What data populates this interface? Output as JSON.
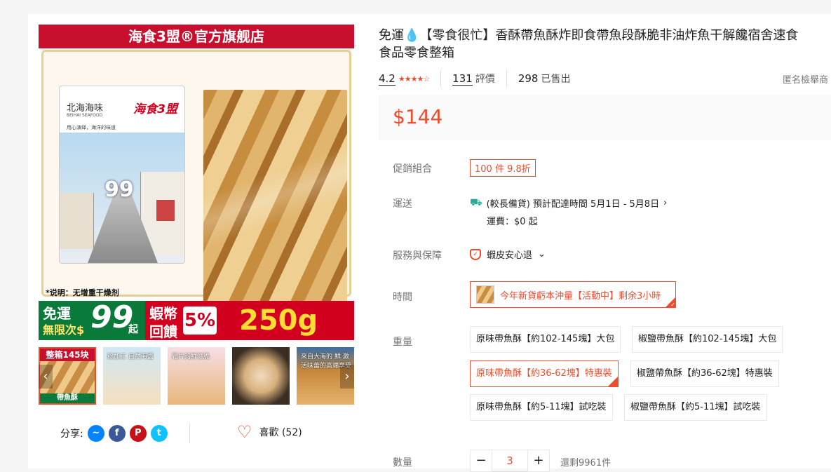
{
  "gallery": {
    "banner_top": "海食3盟®官方旗舰店",
    "package": {
      "name_cn": "北海海味",
      "name_en": "BEIHAI SEAFOOD",
      "brand": "海食3盟",
      "slogan": "用心演绎，海洋的味道",
      "badge": "99"
    },
    "note": "*说明：无增重干燥剂",
    "promo": {
      "free_ship_line1": "免運",
      "free_ship_line2": "無限次",
      "dollar": "$",
      "amount": "99",
      "unit": "起",
      "coin_line1": "蝦幣",
      "coin_line2": "回饋",
      "coin_pct": "5%",
      "weight": "250g"
    },
    "thumbs": [
      {
        "label_top": "整箱145块",
        "label_bottom": "帶魚酥"
      },
      {
        "label": "餘加工 自然海鹽"
      },
      {
        "label": "鬆片的鮮滋脆"
      },
      {
        "label": ""
      },
      {
        "label": "來自大海的 鮮 激活味蕾的高端享受"
      }
    ],
    "prev_arrow": "‹",
    "next_arrow": "›"
  },
  "share": {
    "label": "分享:",
    "icons": [
      "messenger-icon",
      "facebook-icon",
      "pinterest-icon",
      "twitter-icon"
    ]
  },
  "like": {
    "label": "喜歡 (52)"
  },
  "product": {
    "title": "免運💧【零食很忙】香酥帶魚酥炸即食帶魚段酥脆非油炸魚干解饞宿舍速食",
    "title_line2": "食品零食整箱",
    "rating": "4.2",
    "stars": "★★★★☆",
    "reviews_count": "131",
    "reviews_label": "評價",
    "sold_count": "298",
    "sold_label": "已售出",
    "report": "匿名檢舉商",
    "price": "$144"
  },
  "attributes": {
    "promo_label": "促銷組合",
    "promo_value": "100 件 9.8折",
    "shipping_label": "運送",
    "shipping_line": "(較長備貨) 預計配達時間 5月1日 - 5月8日",
    "shipping_fee": "運費：$0 起",
    "service_label": "服務與保障",
    "service_value": "蝦皮安心退",
    "time_label": "時間",
    "time_value": "今年新貨虧本沖量【活動中】剩余3小時",
    "weight_label": "重量",
    "weight_options": [
      "原味帶魚酥【約102-145塊】大包",
      "椒鹽帶魚酥【約102-145塊】大包",
      "原味帶魚酥【約36-62塊】特惠裝",
      "椒鹽帶魚酥【約36-62塊】特惠裝",
      "原味帶魚酥【約5-11塊】試吃裝",
      "椒鹽帶魚酥【約5-11塊】試吃裝"
    ],
    "qty_label": "數量",
    "qty_minus": "−",
    "qty_value": "3",
    "qty_plus": "+",
    "stock": "還剩9961件"
  },
  "colors": {
    "accent": "#ee4d2d",
    "banner_red": "#c8102e",
    "promo_green": "#0a7a3a",
    "truck_teal": "#26aa99"
  }
}
